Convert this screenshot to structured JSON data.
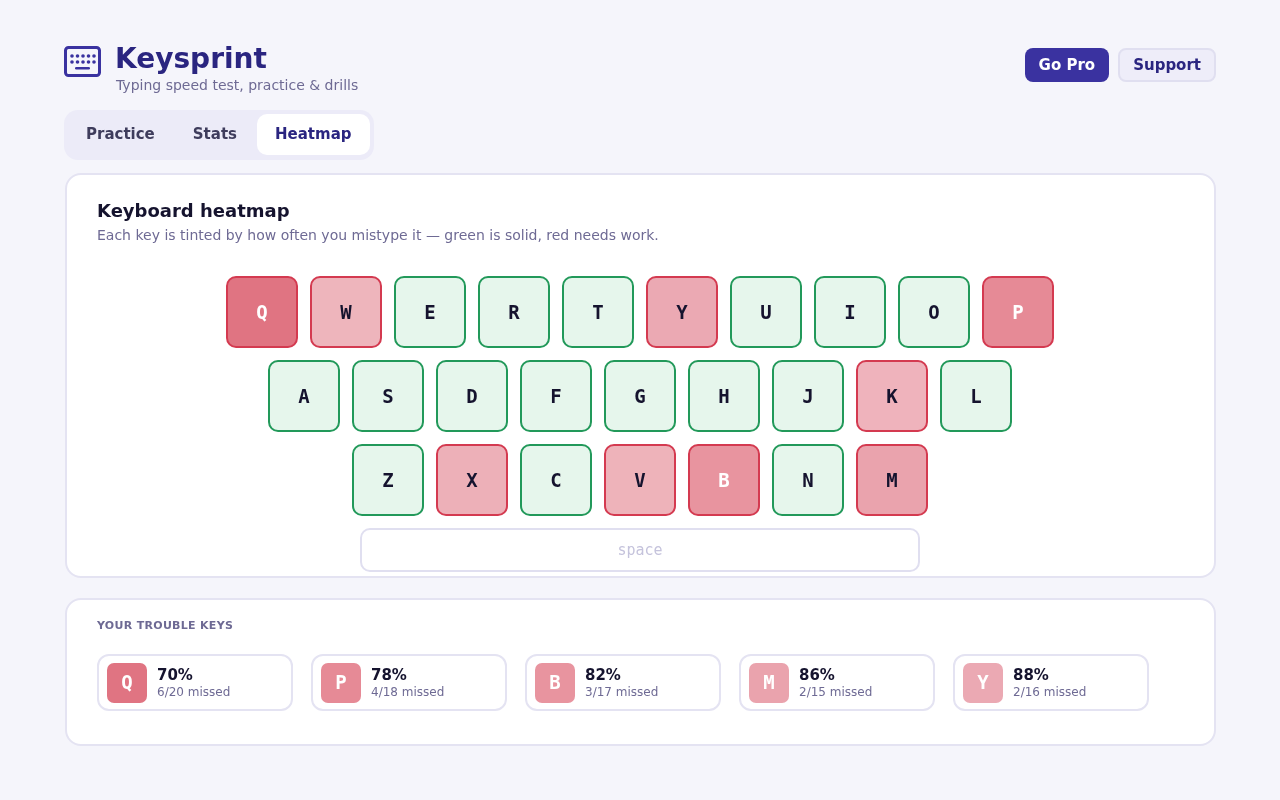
{
  "header": {
    "title": "Keysprint",
    "subtitle": "Typing speed test, practice & drills",
    "buttons": [
      {
        "label": "Go Pro",
        "kind": "primary"
      },
      {
        "label": "Support",
        "kind": "secondary"
      }
    ]
  },
  "tabs": [
    {
      "label": "Practice",
      "selected": false
    },
    {
      "label": "Stats",
      "selected": false
    },
    {
      "label": "Heatmap",
      "selected": true
    }
  ],
  "heatmap": {
    "title": "Keyboard heatmap",
    "description": "Each key is tinted by how often you mistype it — green is solid, red needs work.",
    "rows": [
      [
        {
          "label": "Q",
          "kind": "bad",
          "color": "#e07482"
        },
        {
          "label": "W",
          "kind": "weak",
          "color": "#eeb5bc"
        },
        {
          "label": "E",
          "kind": "good",
          "color": "#e6f6ec"
        },
        {
          "label": "R",
          "kind": "good",
          "color": "#e6f6ec"
        },
        {
          "label": "T",
          "kind": "good",
          "color": "#e6f6ec"
        },
        {
          "label": "Y",
          "kind": "weak",
          "color": "#eba9b3"
        },
        {
          "label": "U",
          "kind": "good",
          "color": "#e6f6ec"
        },
        {
          "label": "I",
          "kind": "good",
          "color": "#e6f6ec"
        },
        {
          "label": "O",
          "kind": "good",
          "color": "#e6f6ec"
        },
        {
          "label": "P",
          "kind": "bad",
          "color": "#e68a96"
        }
      ],
      [
        {
          "label": "A",
          "kind": "good",
          "color": "#e6f6ec"
        },
        {
          "label": "S",
          "kind": "good",
          "color": "#e6f6ec"
        },
        {
          "label": "D",
          "kind": "good",
          "color": "#e6f6ec"
        },
        {
          "label": "F",
          "kind": "good",
          "color": "#e6f6ec"
        },
        {
          "label": "G",
          "kind": "good",
          "color": "#e6f6ec"
        },
        {
          "label": "H",
          "kind": "good",
          "color": "#e6f6ec"
        },
        {
          "label": "J",
          "kind": "good",
          "color": "#e6f6ec"
        },
        {
          "label": "K",
          "kind": "weak",
          "color": "#efb3bc"
        },
        {
          "label": "L",
          "kind": "good",
          "color": "#e6f6ec"
        }
      ],
      [
        {
          "label": "Z",
          "kind": "good",
          "color": "#e6f6ec"
        },
        {
          "label": "X",
          "kind": "weak",
          "color": "#edb0b8"
        },
        {
          "label": "C",
          "kind": "good",
          "color": "#e6f6ec"
        },
        {
          "label": "V",
          "kind": "weak",
          "color": "#eeb3ba"
        },
        {
          "label": "B",
          "kind": "bad",
          "color": "#e8949f"
        },
        {
          "label": "N",
          "kind": "good",
          "color": "#e6f6ec"
        },
        {
          "label": "M",
          "kind": "weak",
          "color": "#eaa3ad"
        }
      ]
    ],
    "space": {
      "label": "space"
    }
  },
  "trouble_keys": {
    "title": "YOUR TROUBLE KEYS",
    "items": [
      {
        "key": "Q",
        "color": "#e07482",
        "score": "70%",
        "missed": "6/20 missed"
      },
      {
        "key": "P",
        "color": "#e68a96",
        "score": "78%",
        "missed": "4/18 missed"
      },
      {
        "key": "B",
        "color": "#e8949f",
        "score": "82%",
        "missed": "3/17 missed"
      },
      {
        "key": "M",
        "color": "#eaa3ad",
        "score": "86%",
        "missed": "2/15 missed"
      },
      {
        "key": "Y",
        "color": "#eba9b3",
        "score": "88%",
        "missed": "2/16 missed"
      }
    ]
  }
}
